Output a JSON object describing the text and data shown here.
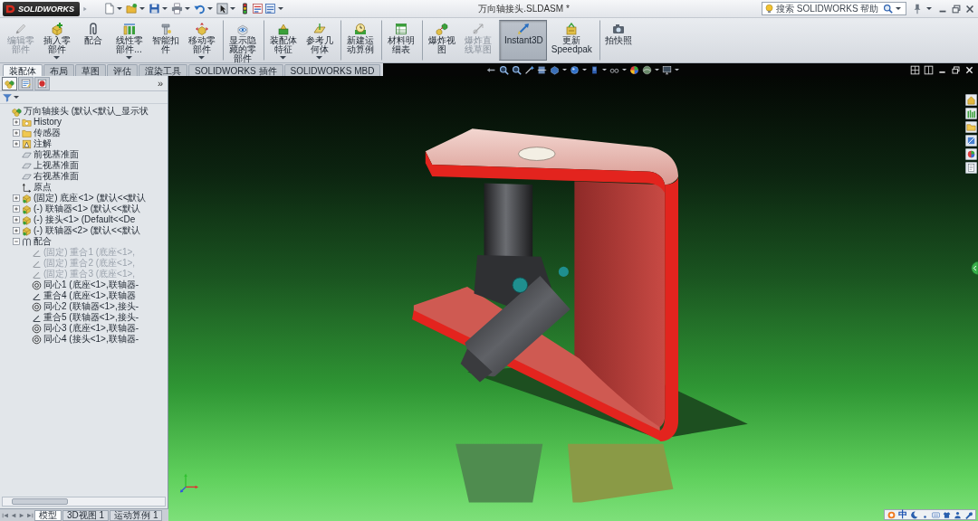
{
  "title_bar": {
    "logo": "SOLIDWORKS",
    "title": "万向轴接头.SLDASM *",
    "search": {
      "placeholder": "搜索 SOLIDWORKS 帮助"
    }
  },
  "ribbon": {
    "buttons": [
      {
        "label": "编辑零部件",
        "disabled": true,
        "selected": false,
        "dropdown": false,
        "separator_before": false
      },
      {
        "label": "插入零部件",
        "disabled": false,
        "selected": false,
        "dropdown": true,
        "separator_before": false
      },
      {
        "label": "配合",
        "disabled": false,
        "selected": false,
        "dropdown": false,
        "separator_before": false
      },
      {
        "label": "线性零部件...",
        "disabled": false,
        "selected": false,
        "dropdown": true,
        "separator_before": false
      },
      {
        "label": "智能扣件",
        "disabled": false,
        "selected": false,
        "dropdown": false,
        "separator_before": false
      },
      {
        "label": "移动零部件",
        "disabled": false,
        "selected": false,
        "dropdown": true,
        "separator_before": false
      },
      {
        "label": "显示隐藏的零部件",
        "disabled": false,
        "selected": false,
        "dropdown": false,
        "separator_before": true
      },
      {
        "label": "装配体特征",
        "disabled": false,
        "selected": false,
        "dropdown": true,
        "separator_before": true
      },
      {
        "label": "参考几何体",
        "disabled": false,
        "selected": false,
        "dropdown": true,
        "separator_before": false
      },
      {
        "label": "新建运动算例",
        "disabled": false,
        "selected": false,
        "dropdown": false,
        "separator_before": true
      },
      {
        "label": "材料明细表",
        "disabled": false,
        "selected": false,
        "dropdown": false,
        "separator_before": true
      },
      {
        "label": "爆炸视图",
        "disabled": false,
        "selected": false,
        "dropdown": false,
        "separator_before": true
      },
      {
        "label": "爆炸直线草图",
        "disabled": true,
        "selected": false,
        "dropdown": false,
        "separator_before": false
      },
      {
        "label": "Instant3D",
        "disabled": false,
        "selected": true,
        "dropdown": false,
        "separator_before": true
      },
      {
        "label": "更新Speedpak",
        "disabled": false,
        "selected": false,
        "dropdown": false,
        "separator_before": false
      },
      {
        "label": "拍快照",
        "disabled": false,
        "selected": false,
        "dropdown": false,
        "separator_before": true
      }
    ]
  },
  "command_tabs": [
    {
      "label": "装配体",
      "selected": true
    },
    {
      "label": "布局",
      "selected": false
    },
    {
      "label": "草图",
      "selected": false
    },
    {
      "label": "评估",
      "selected": false
    },
    {
      "label": "渲染工具",
      "selected": false
    },
    {
      "label": "SOLIDWORKS 插件",
      "selected": false
    },
    {
      "label": "SOLIDWORKS MBD",
      "selected": false
    }
  ],
  "feature_manager": {
    "tabs": [
      {
        "kind": "tree",
        "selected": true
      },
      {
        "kind": "properties",
        "selected": false
      },
      {
        "kind": "display",
        "selected": false
      }
    ],
    "more": "»",
    "tree": [
      {
        "kind": "assembly",
        "label": "万向轴接头 (默认<默认_显示状",
        "children": [
          {
            "kind": "history",
            "label": "History",
            "expanded": false
          },
          {
            "kind": "sensor",
            "label": "传感器",
            "expanded": false
          },
          {
            "kind": "annotation",
            "label": "注解",
            "expanded": false
          },
          {
            "kind": "plane",
            "label": "前视基准面"
          },
          {
            "kind": "plane",
            "label": "上视基准面"
          },
          {
            "kind": "plane",
            "label": "右视基准面"
          },
          {
            "kind": "origin",
            "label": "原点"
          },
          {
            "kind": "part",
            "label": "(固定) 底座<1> (默认<<默认",
            "expanded": false
          },
          {
            "kind": "part",
            "label": "(-) 联轴器<1> (默认<<默认",
            "expanded": false
          },
          {
            "kind": "part",
            "label": "(-) 接头<1> (Default<<De",
            "expanded": false
          },
          {
            "kind": "part",
            "label": "(-) 联轴器<2> (默认<<默认",
            "expanded": false
          },
          {
            "kind": "mates",
            "label": "配合",
            "expanded": true,
            "children": [
              {
                "kind": "coincident",
                "label": "(固定) 重合1 (底座<1>,",
                "disabled": true
              },
              {
                "kind": "coincident",
                "label": "(固定) 重合2 (底座<1>,",
                "disabled": true
              },
              {
                "kind": "coincident",
                "label": "(固定) 重合3 (底座<1>,",
                "disabled": true
              },
              {
                "kind": "concentric",
                "label": "同心1 (底座<1>,联轴器-",
                "disabled": false
              },
              {
                "kind": "coincident",
                "label": "重合4 (底座<1>,联轴器",
                "disabled": false
              },
              {
                "kind": "concentric",
                "label": "同心2 (联轴器<1>,接头-",
                "disabled": false
              },
              {
                "kind": "coincident",
                "label": "重合5 (联轴器<1>,接头-",
                "disabled": false
              },
              {
                "kind": "concentric",
                "label": "同心3 (底座<1>,联轴器-",
                "disabled": false
              },
              {
                "kind": "concentric",
                "label": "同心4 (接头<1>,联轴器-",
                "disabled": false
              }
            ]
          }
        ]
      }
    ]
  },
  "status_bar": {
    "tabs": [
      {
        "label": "模型",
        "selected": true
      },
      {
        "label": "3D视图 1",
        "selected": false
      },
      {
        "label": "运动算例 1",
        "selected": false
      }
    ],
    "ime": "中"
  }
}
